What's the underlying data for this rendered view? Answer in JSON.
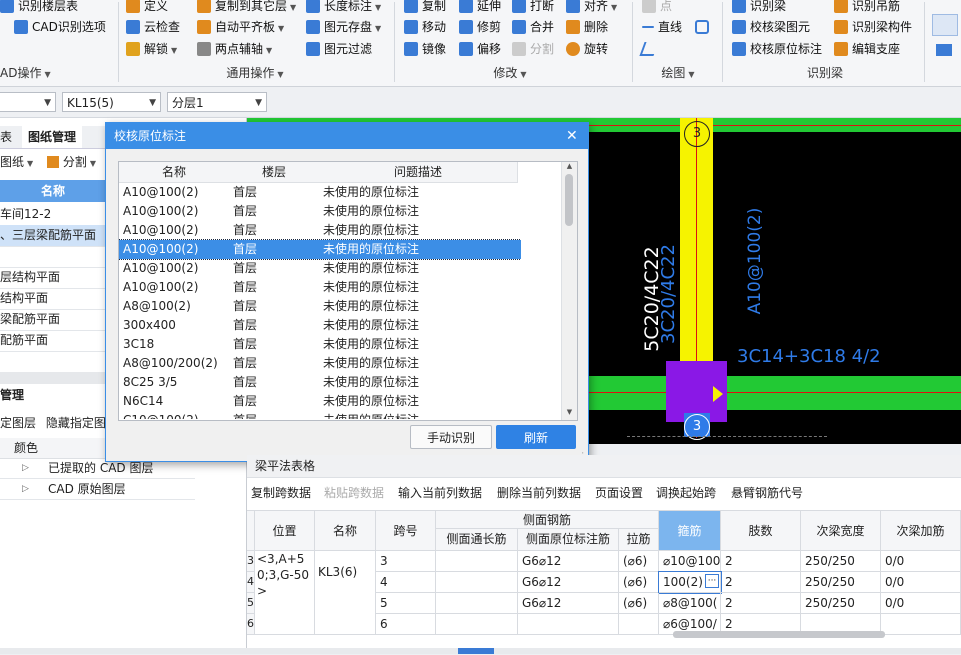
{
  "ribbon": {
    "items": [
      {
        "label": "识别楼层表",
        "icon": "floor-table-icon",
        "color": "#3a7bd5"
      },
      {
        "label": "CAD识别选项",
        "icon": "cad-options-icon",
        "color": "#3a7bd5"
      },
      {
        "label": "AD操作",
        "icon": ""
      },
      {
        "label": "定义",
        "icon": "define-icon",
        "color": "#e08a1e"
      },
      {
        "label": "云检查",
        "icon": "cloud-check-icon",
        "color": "#3a7bd5"
      },
      {
        "label": "解锁",
        "icon": "unlock-icon",
        "color": "#e0a21e"
      },
      {
        "label": "复制到其它层",
        "icon": "copy-layer-icon",
        "color": "#e08a1e"
      },
      {
        "label": "自动平齐板",
        "icon": "align-slab-icon",
        "color": "#e08a1e"
      },
      {
        "label": "两点辅轴",
        "icon": "axis-icon",
        "color": "#888"
      },
      {
        "label": "长度标注",
        "icon": "dimension-icon",
        "color": "#3a7bd5"
      },
      {
        "label": "图元存盘",
        "icon": "save-element-icon",
        "color": "#3a7bd5"
      },
      {
        "label": "图元过滤",
        "icon": "filter-icon",
        "color": "#3a7bd5"
      },
      {
        "label": "复制",
        "icon": "copy-icon",
        "color": "#3a7bd5"
      },
      {
        "label": "延伸",
        "icon": "extend-icon",
        "color": "#3a7bd5"
      },
      {
        "label": "打断",
        "icon": "break-icon",
        "color": "#3a7bd5"
      },
      {
        "label": "对齐",
        "icon": "align-icon",
        "color": "#3a7bd5"
      },
      {
        "label": "移动",
        "icon": "move-icon",
        "color": "#3a7bd5"
      },
      {
        "label": "修剪",
        "icon": "trim-icon",
        "color": "#3a7bd5"
      },
      {
        "label": "合并",
        "icon": "merge-icon",
        "color": "#3a7bd5"
      },
      {
        "label": "删除",
        "icon": "delete-icon",
        "color": "#e08a1e"
      },
      {
        "label": "镜像",
        "icon": "mirror-icon",
        "color": "#3a7bd5"
      },
      {
        "label": "偏移",
        "icon": "offset-icon",
        "color": "#3a7bd5"
      },
      {
        "label": "分割",
        "icon": "split-icon",
        "color": "#aaaaaa"
      },
      {
        "label": "旋转",
        "icon": "rotate-icon",
        "color": "#e08a1e"
      },
      {
        "label": "点",
        "icon": "point-icon",
        "color": "#aaaaaa"
      },
      {
        "label": "直线",
        "icon": "line-icon",
        "color": "#3a7bd5"
      },
      {
        "label": "识别梁",
        "icon": "identify-beam-icon",
        "color": "#3a7bd5"
      },
      {
        "label": "校核梁图元",
        "icon": "check-beam-icon",
        "color": "#3a7bd5"
      },
      {
        "label": "校核原位标注",
        "icon": "check-annotation-icon",
        "color": "#3a7bd5"
      },
      {
        "label": "识别吊筋",
        "icon": "identify-hanger-icon",
        "color": "#e08a1e"
      },
      {
        "label": "识别梁构件",
        "icon": "identify-component-icon",
        "color": "#e08a1e"
      },
      {
        "label": "编辑支座",
        "icon": "edit-support-icon",
        "color": "#e08a1e"
      }
    ],
    "groups": [
      "AD操作",
      "通用操作",
      "修改",
      "绘图",
      "识别梁"
    ]
  },
  "selectors": {
    "beam": "KL15(5)",
    "layer": "分层1"
  },
  "left_panel": {
    "tabs": [
      "表",
      "图纸管理"
    ],
    "toolbar": [
      "图纸",
      "分割"
    ],
    "col_header": "名称",
    "rows": [
      "车间12-2",
      "、三层梁配筋平面",
      "层结构平面",
      "结构平面",
      "梁配筋平面",
      "配筋平面"
    ],
    "section2_title": "管理",
    "section2_toolbar": [
      "定图层",
      "隐藏指定图"
    ],
    "layer_col_header": "颜色",
    "layers": [
      "已提取的 CAD 图层",
      "CAD 原始图层"
    ]
  },
  "canvas": {
    "axis_label_top": "3",
    "axis_label_bottom": "3",
    "text_vertical_1": "5C20/4C22",
    "text_vertical_2": "3C20/4C22",
    "text_vertical_3": "A10@100(2)",
    "text_beam": "3C14+3C18 4/2"
  },
  "dialog": {
    "title": "校核原位标注",
    "columns": [
      "名称",
      "楼层",
      "问题描述"
    ],
    "rows": [
      {
        "name": "A10@100(2)",
        "floor": "首层",
        "desc": "未使用的原位标注"
      },
      {
        "name": "A10@100(2)",
        "floor": "首层",
        "desc": "未使用的原位标注"
      },
      {
        "name": "A10@100(2)",
        "floor": "首层",
        "desc": "未使用的原位标注"
      },
      {
        "name": "A10@100(2)",
        "floor": "首层",
        "desc": "未使用的原位标注",
        "selected": true
      },
      {
        "name": "A10@100(2)",
        "floor": "首层",
        "desc": "未使用的原位标注"
      },
      {
        "name": "A10@100(2)",
        "floor": "首层",
        "desc": "未使用的原位标注"
      },
      {
        "name": "A8@100(2)",
        "floor": "首层",
        "desc": "未使用的原位标注"
      },
      {
        "name": "300x400",
        "floor": "首层",
        "desc": "未使用的原位标注"
      },
      {
        "name": "3C18",
        "floor": "首层",
        "desc": "未使用的原位标注"
      },
      {
        "name": "A8@100/200(2)",
        "floor": "首层",
        "desc": "未使用的原位标注"
      },
      {
        "name": "8C25 3/5",
        "floor": "首层",
        "desc": "未使用的原位标注"
      },
      {
        "name": "N6C14",
        "floor": "首层",
        "desc": "未使用的原位标注"
      },
      {
        "name": "C10@100(2)",
        "floor": "首层",
        "desc": "未使用的原位标注"
      }
    ],
    "btn_manual": "手动识别",
    "btn_refresh": "刷新"
  },
  "beam_table": {
    "title": "梁平法表格",
    "toolbar": [
      "复制跨数据",
      "粘贴跨数据",
      "输入当前列数据",
      "删除当前列数据",
      "页面设置",
      "调换起始跨",
      "悬臂钢筋代号"
    ],
    "headers": {
      "position": "位置",
      "name": "名称",
      "span": "跨号",
      "side_group": "侧面钢筋",
      "side_through": "侧面通长筋",
      "side_insitu": "侧面原位标注筋",
      "tie": "拉筋",
      "stirrup": "箍筋",
      "legs": "肢数",
      "sec_width": "次梁宽度",
      "sec_add": "次梁加筋"
    },
    "position_value": "<3,A+50;3,G-50>",
    "name_value": "KL3(6)",
    "rows": [
      {
        "idx": "3",
        "span": "3",
        "side_insitu": "G6⌀12",
        "tie": "(⌀6)",
        "stirrup": "⌀10@100",
        "legs": "2",
        "sec_width": "250/250",
        "sec_add": "0/0"
      },
      {
        "idx": "4",
        "span": "4",
        "side_insitu": "G6⌀12",
        "tie": "(⌀6)",
        "stirrup": "100(2)",
        "legs": "2",
        "sec_width": "250/250",
        "sec_add": "0/0"
      },
      {
        "idx": "5",
        "span": "5",
        "side_insitu": "G6⌀12",
        "tie": "(⌀6)",
        "stirrup": "⌀8@100(",
        "legs": "2",
        "sec_width": "250/250",
        "sec_add": "0/0"
      },
      {
        "idx": "6",
        "span": "6",
        "side_insitu": "",
        "tie": "",
        "stirrup": "⌀6@100/",
        "legs": "2",
        "sec_width": "",
        "sec_add": ""
      }
    ]
  }
}
